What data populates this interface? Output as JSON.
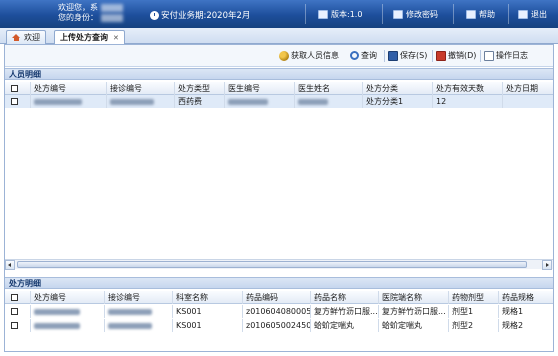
{
  "header": {
    "welcome_line1": "欢迎您，系",
    "welcome_line1_suffix": "统管理员",
    "welcome_line2": "您的身份：",
    "business_month": "安付业务期:2020年2月",
    "version": "版本:1.0",
    "change_password": "修改密码",
    "help": "帮助",
    "exit": "退出"
  },
  "tabs": [
    {
      "label": "欢迎",
      "active": false
    },
    {
      "label": "上传处方查询",
      "active": true
    }
  ],
  "toolbar": {
    "fetch_person": "获取人员信息",
    "query": "查询",
    "save": "保存(S)",
    "revoke": "撤销(D)",
    "op_log": "操作日志"
  },
  "person_section": {
    "title": "人员明细",
    "columns": [
      "处方编号",
      "接诊编号",
      "处方类型",
      "医生编号",
      "医生姓名",
      "处方分类",
      "处方有效天数",
      "处方日期"
    ],
    "rows": [
      {
        "prescription_type": "西药费",
        "category": "处方分类1",
        "valid_days": "12"
      }
    ]
  },
  "detail_section": {
    "title": "处方明细",
    "columns": [
      "处方编号",
      "接诊编号",
      "科室名称",
      "药品编码",
      "药品名称",
      "医院端名称",
      "药物剂型",
      "药品规格"
    ],
    "rows": [
      {
        "dept": "KS001",
        "drug_code": "z010604080005a",
        "drug_name": "复方鲜竹沥口服...",
        "hosp_name": "复方鲜竹沥口服...",
        "dosage_form": "剂型1",
        "spec": "规格1"
      },
      {
        "dept": "KS001",
        "drug_code": "z010605002450",
        "drug_name": "蛤蚧定喘丸",
        "hosp_name": "蛤蚧定喘丸",
        "dosage_form": "剂型2",
        "spec": "规格2"
      }
    ]
  },
  "colors": {
    "banner": "#1d4e9b",
    "selected_row": "#dfeaf8",
    "section_header": "#c6d6ee"
  }
}
